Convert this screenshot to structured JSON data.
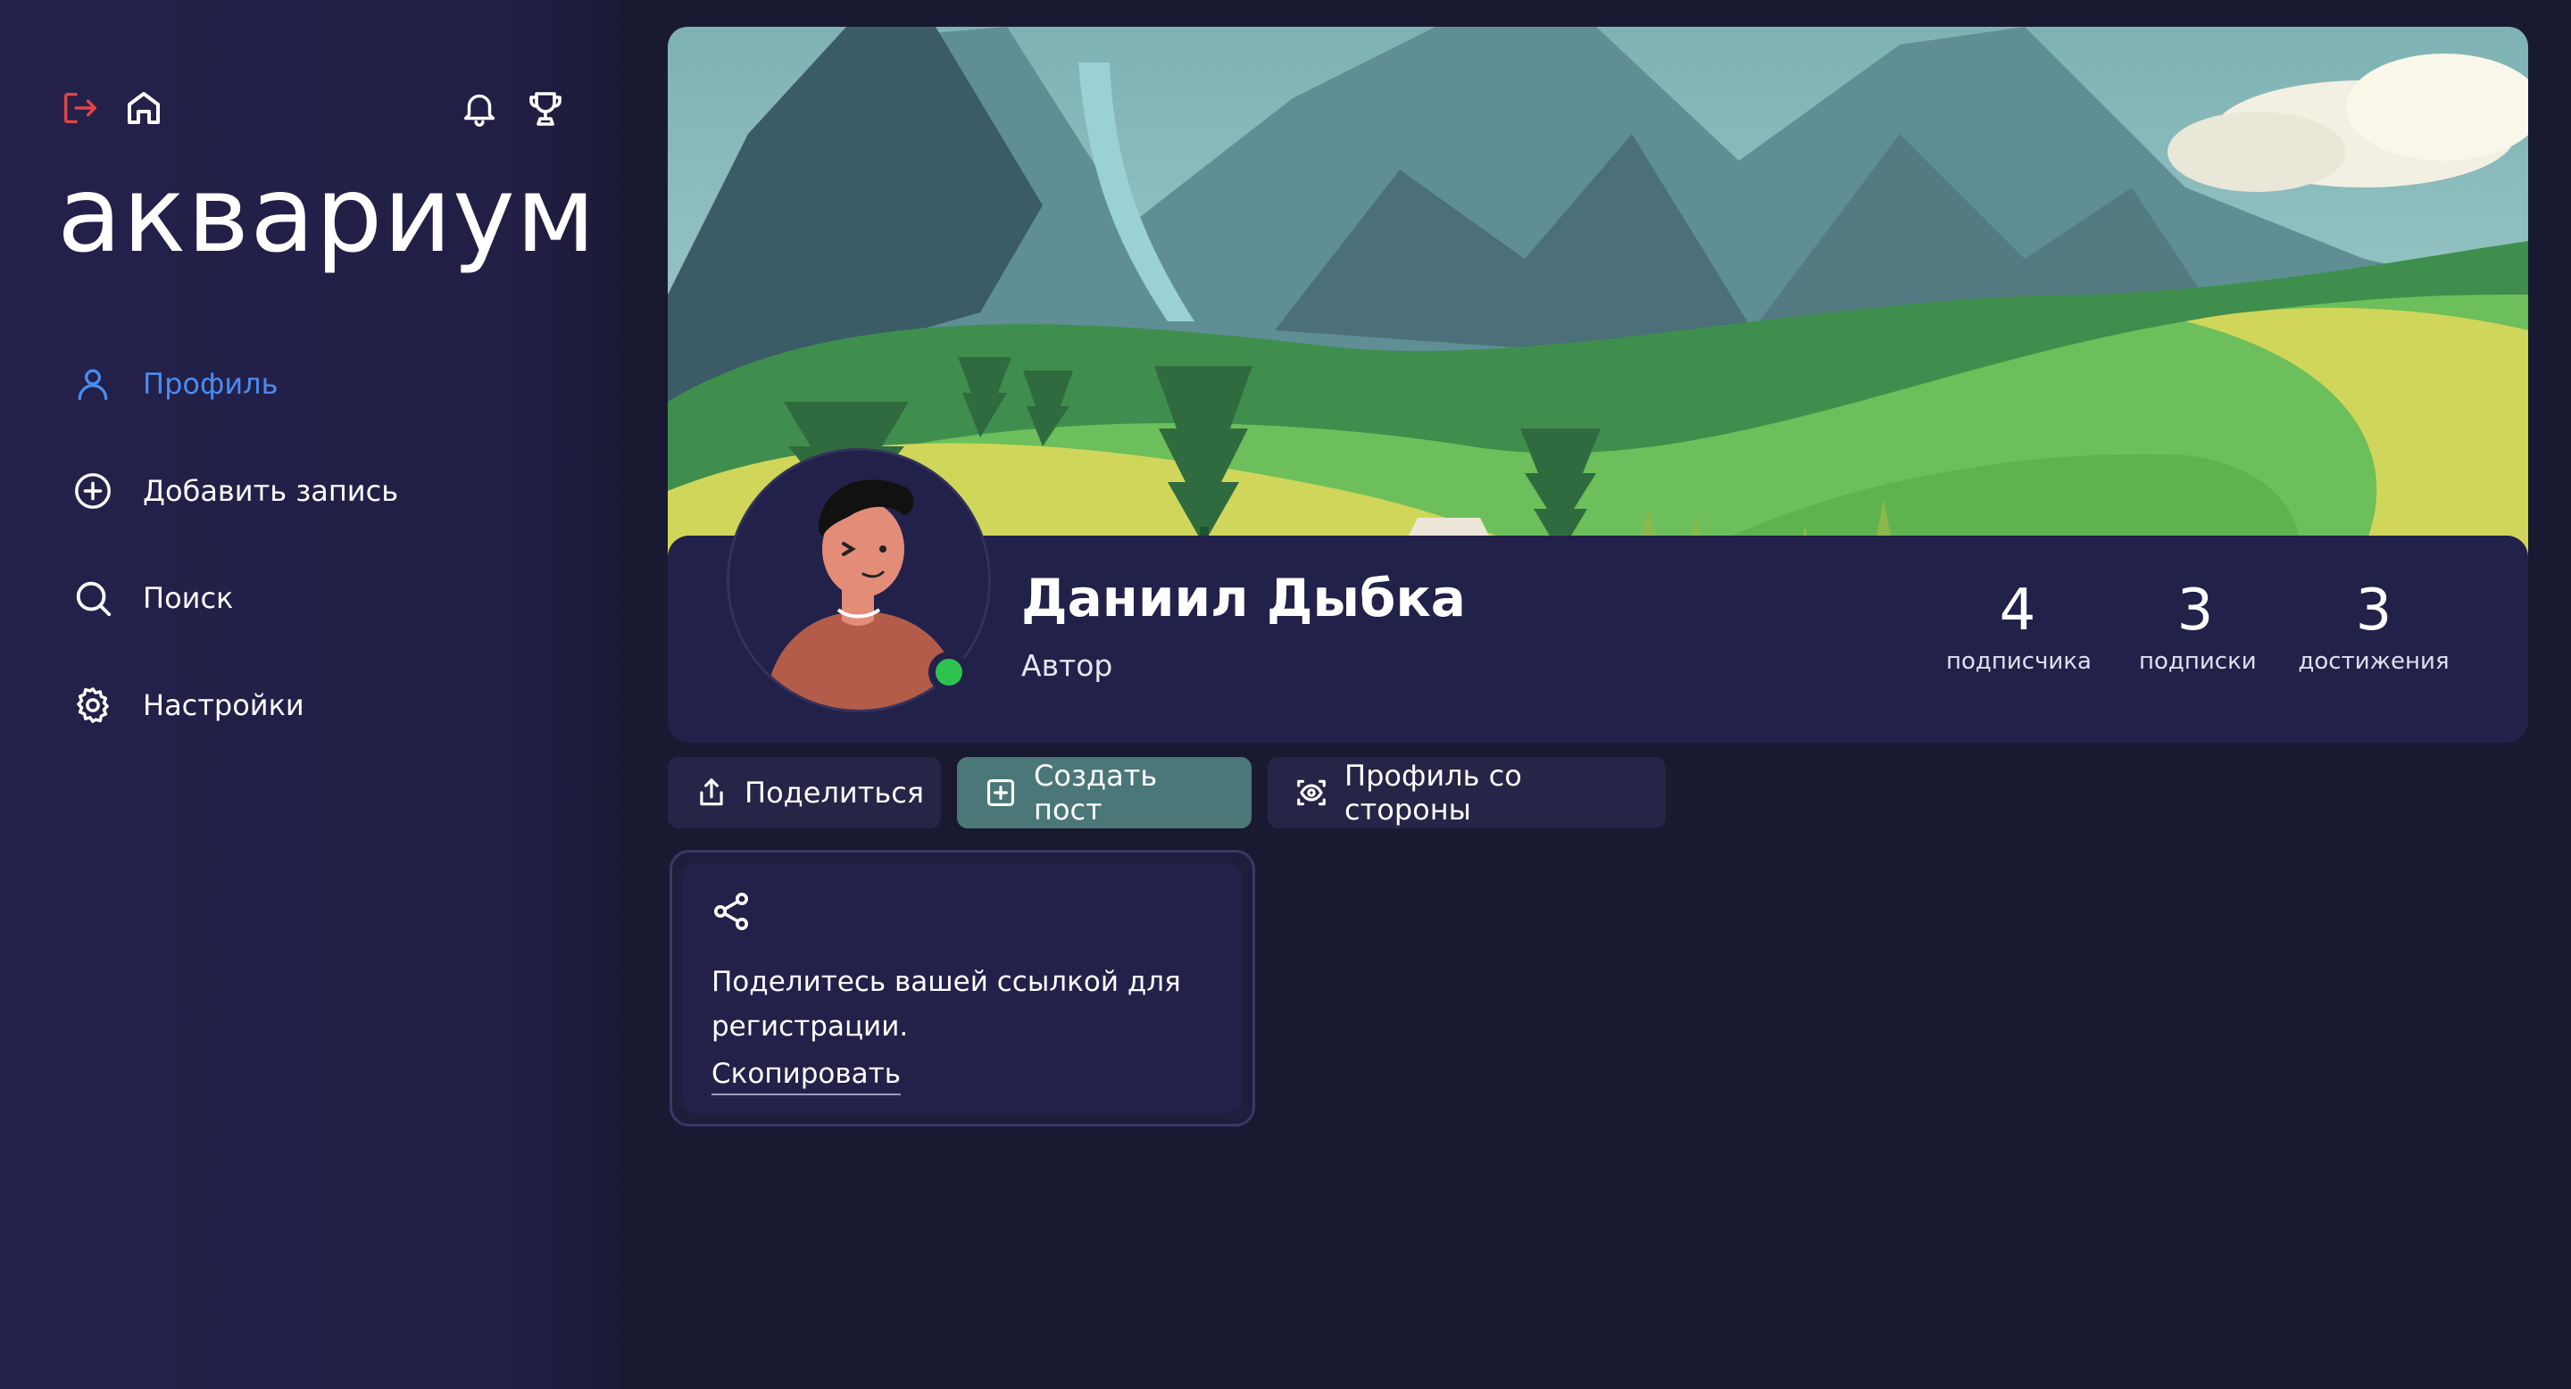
{
  "app": {
    "logo_text": "аквариум"
  },
  "sidebar": {
    "top_icons": [
      "logout-icon",
      "home-icon",
      "bell-icon",
      "trophy-icon"
    ],
    "nav_items": [
      {
        "label": "Профиль",
        "icon": "user-icon",
        "active": true
      },
      {
        "label": "Добавить запись",
        "icon": "plus-circle-icon",
        "active": false
      },
      {
        "label": "Поиск",
        "icon": "search-icon",
        "active": false
      },
      {
        "label": "Настройки",
        "icon": "gear-icon",
        "active": false
      }
    ]
  },
  "profile": {
    "name": "Даниил Дыбка",
    "role": "Автор",
    "online": true,
    "stats": [
      {
        "value": "4",
        "label": "подписчика"
      },
      {
        "value": "3",
        "label": "подписки"
      },
      {
        "value": "3",
        "label": "достижения"
      }
    ]
  },
  "actions": {
    "share_label": "Поделиться",
    "create_post_label": "Создать пост",
    "view_profile_label": "Профиль со стороны"
  },
  "share_card": {
    "text": "Поделитесь вашей ссылкой для регистрации.",
    "copy_label": "Скопировать"
  },
  "colors": {
    "background": "#1a1932",
    "sidebar": "#23214a",
    "card": "#22214a",
    "accent_blue": "#4a8cf0",
    "primary_button": "#4b7778",
    "online": "#2ec24f",
    "logout_red": "#e04545"
  }
}
